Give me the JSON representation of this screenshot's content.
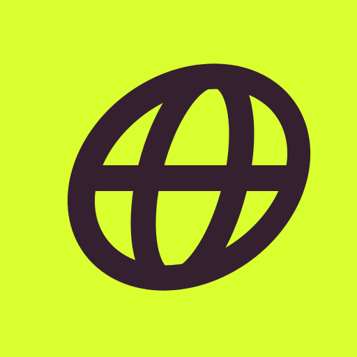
{
  "icon": {
    "name": "globe-icon",
    "background_color": "#DAFF2E",
    "foreground_color": "#35202F"
  }
}
